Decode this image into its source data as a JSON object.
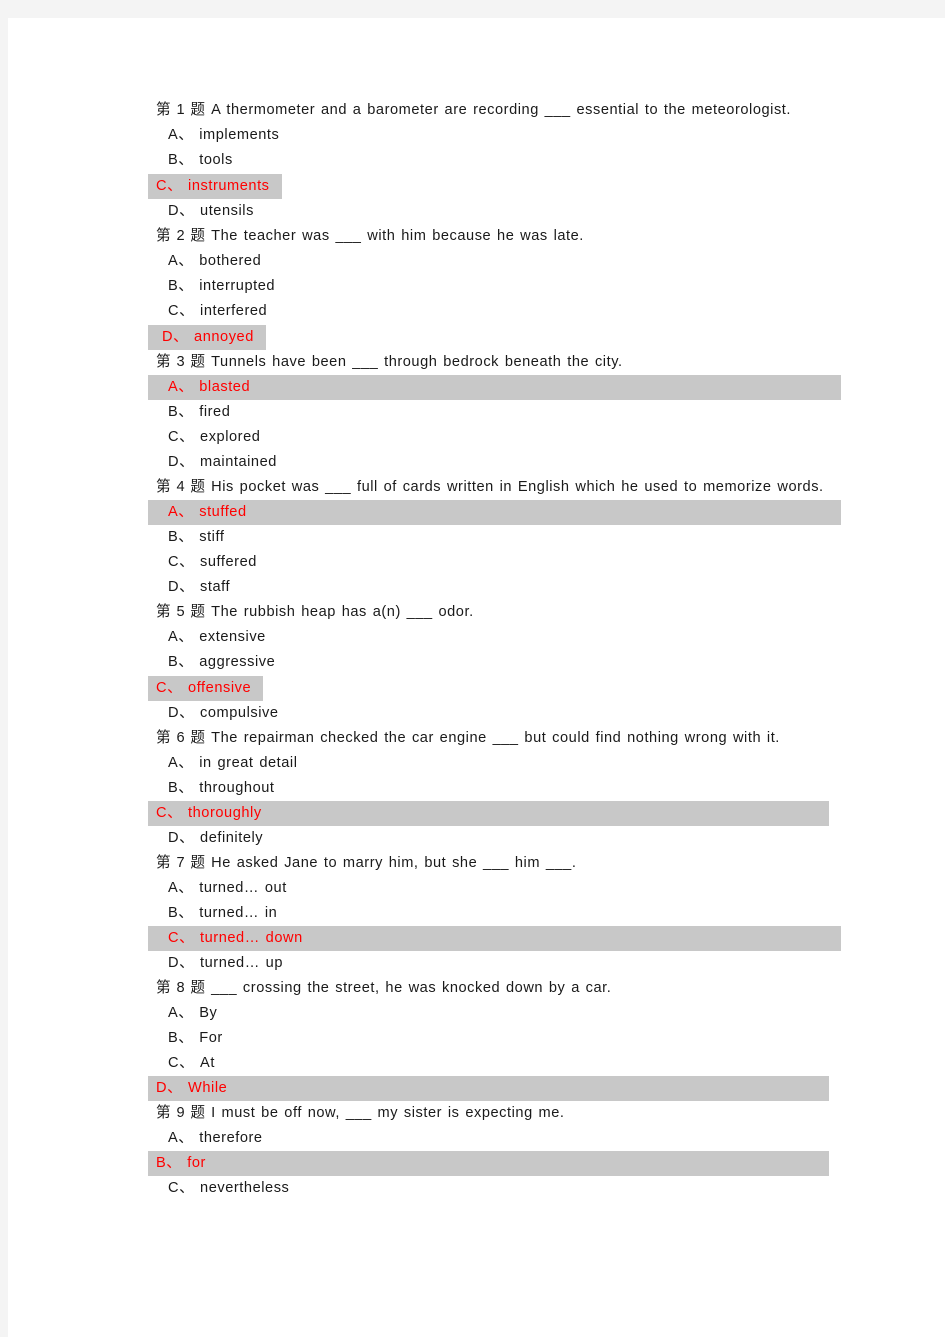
{
  "document": {
    "type": "multiple-choice-quiz",
    "language": "zh-en",
    "question_prefix": "第",
    "question_suffix": "题",
    "option_separator": "、",
    "answer_highlight_color": "#c8c8c8",
    "answer_text_color": "#ff0000",
    "body_text_color": "#1a1a1a",
    "page_background": "#ffffff",
    "canvas_background": "#f4f4f4"
  },
  "questions": [
    {
      "number": "1",
      "prompt": "A thermometer and a barometer are recording ___ essential to the meteorologist.",
      "options": [
        {
          "letter": "A",
          "text": "implements",
          "highlighted": false,
          "highlight_style": "none"
        },
        {
          "letter": "B",
          "text": "tools",
          "highlighted": false,
          "highlight_style": "none"
        },
        {
          "letter": "C",
          "text": "instruments",
          "highlighted": true,
          "highlight_style": "fit"
        },
        {
          "letter": "D",
          "text": "utensils",
          "highlighted": false,
          "highlight_style": "none"
        }
      ],
      "answer": "C"
    },
    {
      "number": "2",
      "prompt": "The teacher was ___ with him because he was late.",
      "options": [
        {
          "letter": "A",
          "text": "bothered",
          "highlighted": false,
          "highlight_style": "none"
        },
        {
          "letter": "B",
          "text": "interrupted",
          "highlighted": false,
          "highlight_style": "none"
        },
        {
          "letter": "C",
          "text": "interfered",
          "highlighted": false,
          "highlight_style": "none"
        },
        {
          "letter": "D",
          "text": "annoyed",
          "highlighted": true,
          "highlight_style": "fit-indent"
        }
      ],
      "answer": "D"
    },
    {
      "number": "3",
      "prompt": "Tunnels have been ___ through bedrock beneath the city.",
      "options": [
        {
          "letter": "A",
          "text": "blasted",
          "highlighted": true,
          "highlight_style": "full-indent"
        },
        {
          "letter": "B",
          "text": "fired",
          "highlighted": false,
          "highlight_style": "none"
        },
        {
          "letter": "C",
          "text": "explored",
          "highlighted": false,
          "highlight_style": "none"
        },
        {
          "letter": "D",
          "text": "maintained",
          "highlighted": false,
          "highlight_style": "none"
        }
      ],
      "answer": "A"
    },
    {
      "number": "4",
      "prompt": "His pocket was ___ full of cards written in English which he used to memorize words.",
      "options": [
        {
          "letter": "A",
          "text": "stuffed",
          "highlighted": true,
          "highlight_style": "full-indent"
        },
        {
          "letter": "B",
          "text": "stiff",
          "highlighted": false,
          "highlight_style": "none"
        },
        {
          "letter": "C",
          "text": "suffered",
          "highlighted": false,
          "highlight_style": "none"
        },
        {
          "letter": "D",
          "text": "staff",
          "highlighted": false,
          "highlight_style": "none"
        }
      ],
      "answer": "A"
    },
    {
      "number": "5",
      "prompt": "The rubbish heap has a(n) ___ odor.",
      "options": [
        {
          "letter": "A",
          "text": "extensive",
          "highlighted": false,
          "highlight_style": "none"
        },
        {
          "letter": "B",
          "text": "aggressive",
          "highlighted": false,
          "highlight_style": "none"
        },
        {
          "letter": "C",
          "text": "offensive",
          "highlighted": true,
          "highlight_style": "fit"
        },
        {
          "letter": "D",
          "text": "compulsive",
          "highlighted": false,
          "highlight_style": "none"
        }
      ],
      "answer": "C"
    },
    {
      "number": "6",
      "prompt": "The repairman checked the car engine ___ but could find nothing wrong with it.",
      "options": [
        {
          "letter": "A",
          "text": "in great detail",
          "highlighted": false,
          "highlight_style": "none"
        },
        {
          "letter": "B",
          "text": "throughout",
          "highlighted": false,
          "highlight_style": "none"
        },
        {
          "letter": "C",
          "text": "thoroughly",
          "highlighted": true,
          "highlight_style": "full"
        },
        {
          "letter": "D",
          "text": "definitely",
          "highlighted": false,
          "highlight_style": "none"
        }
      ],
      "answer": "C"
    },
    {
      "number": "7",
      "prompt": "He asked Jane to marry him, but she ___ him ___.",
      "options": [
        {
          "letter": "A",
          "text": "turned… out",
          "highlighted": false,
          "highlight_style": "none"
        },
        {
          "letter": "B",
          "text": "turned… in",
          "highlighted": false,
          "highlight_style": "none"
        },
        {
          "letter": "C",
          "text": "turned… down",
          "highlighted": true,
          "highlight_style": "full-indent"
        },
        {
          "letter": "D",
          "text": "turned… up",
          "highlighted": false,
          "highlight_style": "none"
        }
      ],
      "answer": "C"
    },
    {
      "number": "8",
      "prompt": "___ crossing the street, he was knocked down by a car.",
      "options": [
        {
          "letter": "A",
          "text": "By",
          "highlighted": false,
          "highlight_style": "none"
        },
        {
          "letter": "B",
          "text": "For",
          "highlighted": false,
          "highlight_style": "none"
        },
        {
          "letter": "C",
          "text": "At",
          "highlighted": false,
          "highlight_style": "none"
        },
        {
          "letter": "D",
          "text": "While",
          "highlighted": true,
          "highlight_style": "full"
        }
      ],
      "answer": "D"
    },
    {
      "number": "9",
      "prompt": "I must be off now, ___ my sister is expecting me.",
      "options": [
        {
          "letter": "A",
          "text": "therefore",
          "highlighted": false,
          "highlight_style": "none"
        },
        {
          "letter": "B",
          "text": "for",
          "highlighted": true,
          "highlight_style": "full"
        },
        {
          "letter": "C",
          "text": "nevertheless",
          "highlighted": false,
          "highlight_style": "none"
        }
      ],
      "answer": "B"
    }
  ]
}
